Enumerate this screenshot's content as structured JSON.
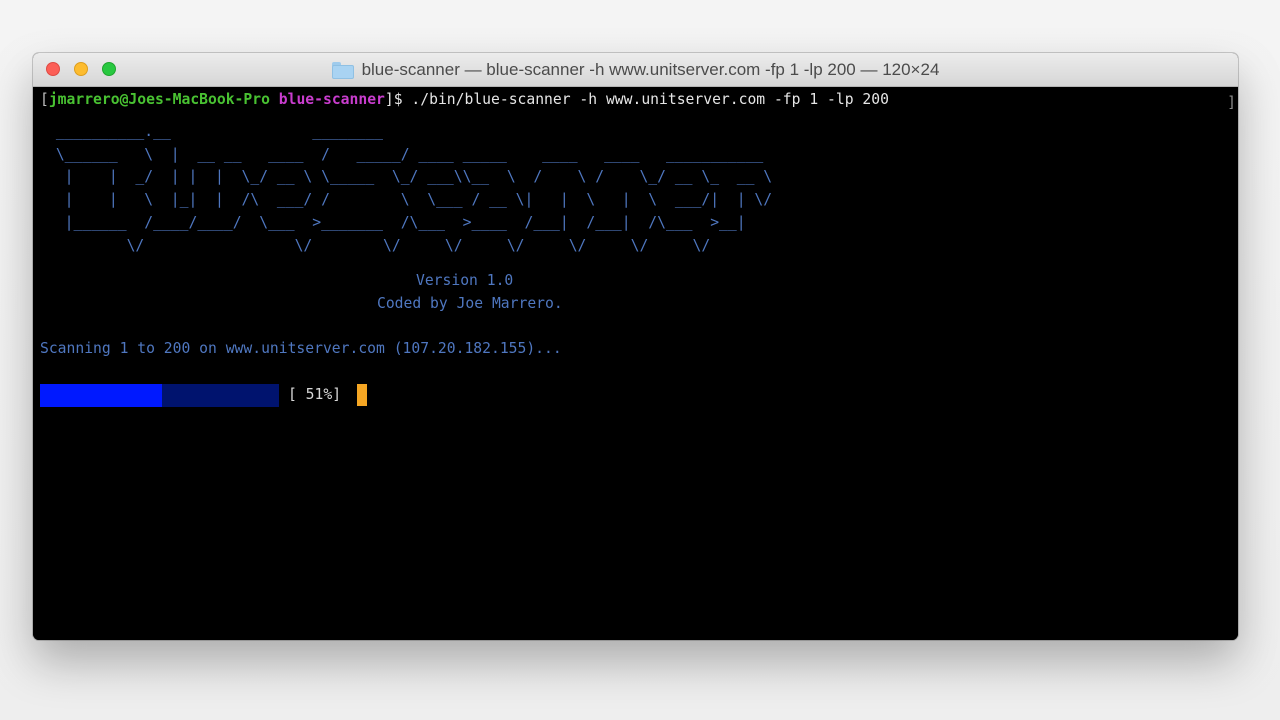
{
  "window": {
    "title": "blue-scanner — blue-scanner -h www.unitserver.com -fp 1 -lp 200 — 120×24",
    "folder_icon": "folder-icon",
    "colors": {
      "close": "#fc5f57",
      "minimize": "#fdbc2f",
      "zoom": "#28c840"
    }
  },
  "terminal": {
    "prompt": {
      "open_bracket": "[",
      "user_host": "jmarrero@Joes-MacBook-Pro",
      "space": " ",
      "cwd": "blue-scanner",
      "close": "]$ ",
      "command": "./bin/blue-scanner -h www.unitserver.com -fp 1 -lp 200"
    },
    "scroll_marker": "]",
    "banner_ascii": " __________.__                ________                                      \n \\______   \\  |  __ __   ____  /   _____/ ____ _____    ____   ____   ___________\n  |    |  _/  | |  |  \\_/ __ \\ \\_____  \\_/ ___\\\\__  \\  /    \\ /    \\_/ __ \\_  __ \\\n  |    |   \\  |_|  |  /\\  ___/ /        \\  \\___ / __ \\|   |  \\   |  \\  ___/|  | \\/\n  |______  /____/____/  \\___  >_______  /\\___  >____  /___|  /___|  /\\___  >__|\n         \\/                 \\/        \\/     \\/     \\/     \\/     \\/     \\/",
    "version_line": "Version 1.0",
    "coded_by_line": "Coded by Joe Marrero.",
    "scanning_line": "Scanning 1 to 200 on www.unitserver.com (107.20.182.155)...",
    "progress": {
      "percent": 51,
      "label": "[ 51%]",
      "fill_color": "#0019ff",
      "track_color": "#00136e"
    },
    "cursor_color": "#f5a623",
    "text_colors": {
      "user_host": "#49c232",
      "cwd": "#c93dce",
      "banner": "#4f77c0"
    }
  }
}
